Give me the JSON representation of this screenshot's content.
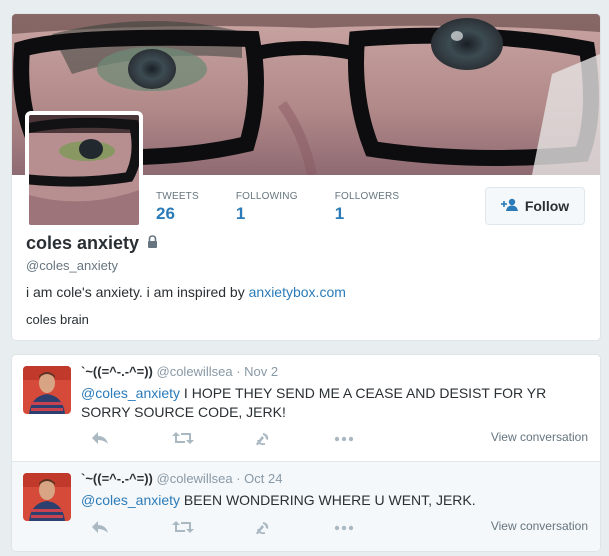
{
  "profile": {
    "stats": [
      {
        "label": "TWEETS",
        "value": "26"
      },
      {
        "label": "FOLLOWING",
        "value": "1"
      },
      {
        "label": "FOLLOWERS",
        "value": "1"
      }
    ],
    "follow_label": "Follow",
    "follow_icon": "add-user-icon",
    "name": "coles anxiety",
    "lock_icon": "lock-icon",
    "handle": "@coles_anxiety",
    "bio_text": "i am cole's anxiety. i am inspired by ",
    "bio_link": "anxietybox.com",
    "location": "coles brain"
  },
  "tweets": [
    {
      "name": "`~((=^-.-^=))",
      "handle": "@colewillsea",
      "separator": "·",
      "date": "Nov 2",
      "mention": "@coles_anxiety",
      "text": " I HOPE THEY SEND ME A CEASE AND DESIST FOR YR SORRY SOURCE CODE, JERK!",
      "view_conversation": "View conversation"
    },
    {
      "name": "`~((=^-.-^=))",
      "handle": "@colewillsea",
      "separator": "·",
      "date": "Oct 24",
      "mention": "@coles_anxiety",
      "text": " BEEN WONDERING WHERE U WENT, JERK.",
      "view_conversation": "View conversation"
    }
  ],
  "tweet_action_icons": [
    "reply-icon",
    "retweet-icon",
    "favorite-icon",
    "more-icon"
  ],
  "colors": {
    "link": "#2b7bb9",
    "text": "#292f33",
    "muted": "#8899a6",
    "action": "#aab8c2"
  }
}
